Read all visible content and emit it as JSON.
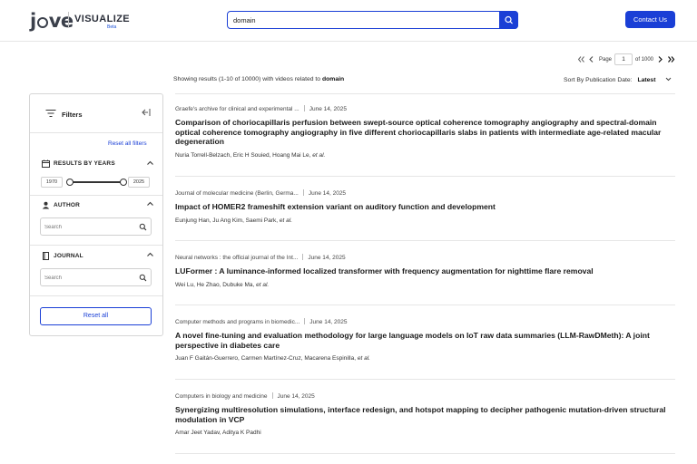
{
  "header": {
    "logo_text": "jove",
    "brand": "VISUALIZE",
    "beta": "Beta",
    "search_value": "domain",
    "contact_label": "Contact Us"
  },
  "pager": {
    "page_label": "Page",
    "current_page": "1",
    "of_label": "of 1000"
  },
  "summary": {
    "prefix": "Showing results (1-10 of 10000) with videos related to",
    "query": "domain"
  },
  "sort": {
    "label": "Sort By Publication Date:",
    "value": "Latest"
  },
  "filters": {
    "title": "Filters",
    "reset_filters": "Reset all filters",
    "years_title": "RESULTS BY YEARS",
    "year_min": "1970",
    "year_max": "2025",
    "author_title": "AUTHOR",
    "author_placeholder": "Search",
    "journal_title": "JOURNAL",
    "journal_placeholder": "Search",
    "reset_all": "Reset all"
  },
  "results": [
    {
      "journal": "Graefe's archive for clinical and experimental ...",
      "date": "June 14, 2025",
      "title": "Comparison of choriocapillaris perfusion between swept-source optical coherence tomography angiography and spectral-domain optical coherence tomography angiography in five different choriocapillaris slabs in patients with intermediate age-related macular degeneration",
      "authors": "Nuria Torrell-Belzach, Eric H Souied, Hoang Mai Le,",
      "etal": "et al."
    },
    {
      "journal": "Journal of molecular medicine (Berlin, Germa...",
      "date": "June 14, 2025",
      "title": "Impact of HOMER2 frameshift extension variant on auditory function and development",
      "authors": "Eunjung Han, Ju Ang Kim, Saemi Park,",
      "etal": "et al."
    },
    {
      "journal": "Neural networks : the official journal of the Int...",
      "date": "June 14, 2025",
      "title": "LUFormer : A luminance-informed localized transformer with frequency augmentation for nighttime flare removal",
      "authors": "Wei Lu, He Zhao, Dubuke Ma,",
      "etal": "et al."
    },
    {
      "journal": "Computer methods and programs in biomedic...",
      "date": "June 14, 2025",
      "title": "A novel fine-tuning and evaluation methodology for large language models on IoT raw data summaries (LLM-RawDMeth): A joint perspective in diabetes care",
      "authors": "Juan F Gaitán-Guerrero, Carmen Martínez-Cruz, Macarena Espinilla,",
      "etal": "et al."
    },
    {
      "journal": "Computers in biology and medicine",
      "date": "June 14, 2025",
      "title": "Synergizing multiresolution simulations, interface redesign, and hotspot mapping to decipher pathogenic mutation-driven structural modulation in VCP",
      "authors": "Amar Jeet Yadav, Aditya K Padhi",
      "etal": ""
    }
  ]
}
